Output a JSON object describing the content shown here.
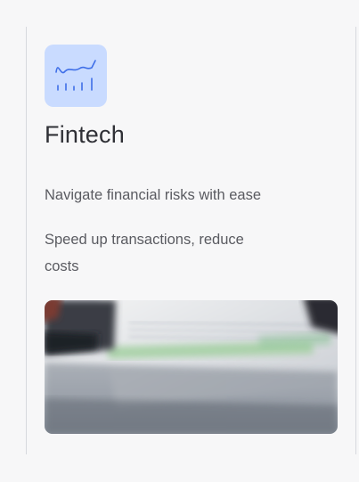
{
  "card": {
    "title": "Fintech",
    "icon": "chart-trend-icon",
    "features": [
      "Navigate financial risks with ease",
      "Speed up transactions, reduce costs"
    ],
    "image": "fintech-photo",
    "colors": {
      "icon_tile": "#c9dbff",
      "icon_stroke": "#3f6fe8",
      "title": "#2f3036",
      "body_text": "#5a5b61",
      "background": "#f7f7f8"
    }
  }
}
